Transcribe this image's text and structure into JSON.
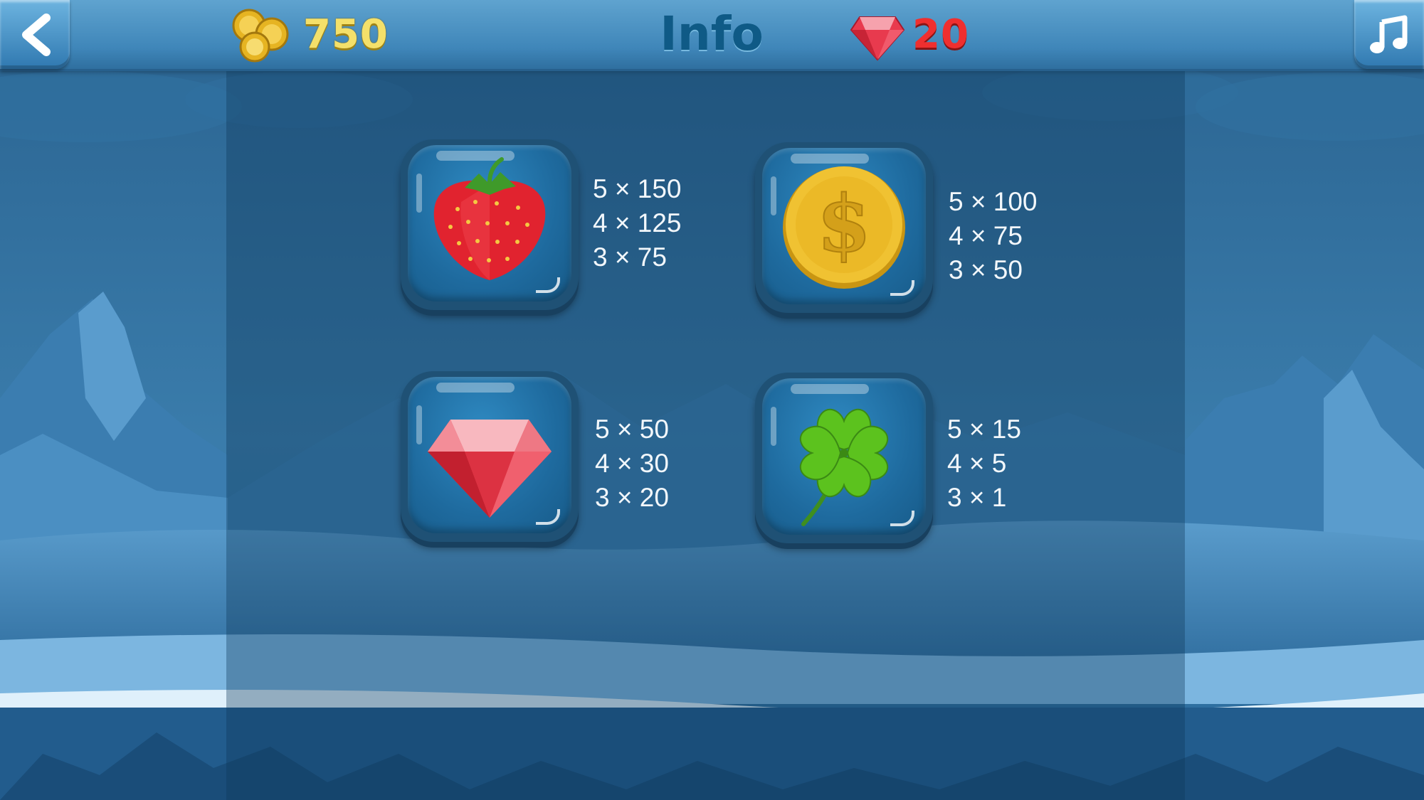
{
  "header": {
    "coins": "750",
    "title": "Info",
    "gems": "20"
  },
  "icons": {
    "back": "chevron-left-icon",
    "music": "music-note-icon",
    "coins": "gold-coins-icon",
    "gems": "red-gem-icon"
  },
  "colors": {
    "coins_text": "#f4e06a",
    "title_text": "#0f5a86",
    "gems_text": "#ef2f2f",
    "tile": "#1e6a9e"
  },
  "symbols": [
    {
      "name": "strawberry",
      "payouts": [
        "5 × 150",
        "4 × 125",
        "3 × 75"
      ]
    },
    {
      "name": "gold-coin",
      "payouts": [
        "5 × 100",
        "4 × 75",
        "3 × 50"
      ]
    },
    {
      "name": "ruby",
      "payouts": [
        "5 × 50",
        "4 × 30",
        "3 × 20"
      ]
    },
    {
      "name": "four-leaf-clover",
      "payouts": [
        "5 × 15",
        "4 × 5",
        "3 × 1"
      ]
    }
  ]
}
